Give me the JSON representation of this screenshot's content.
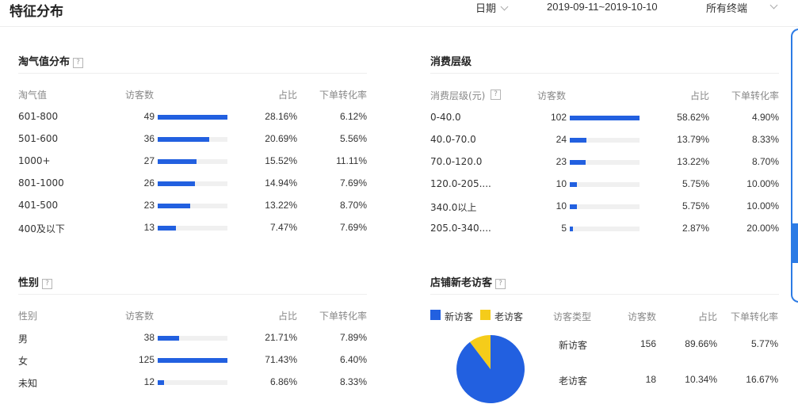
{
  "header": {
    "title": "特征分布",
    "date_label": "日期",
    "date_range": "2019-09-11~2019-10-10",
    "terminal": "所有终端"
  },
  "colors": {
    "bar": "#2260e0",
    "new_visitor": "#2260e0",
    "old_visitor": "#f5cc1a",
    "track": "#f0f0f0"
  },
  "taoqi": {
    "title": "淘气值分布",
    "help": "?",
    "headers": [
      "淘气值",
      "访客数",
      "占比",
      "下单转化率"
    ],
    "rows": [
      {
        "label": "601-800",
        "visitors": "49",
        "share": "28.16%",
        "conv": "6.12%"
      },
      {
        "label": "501-600",
        "visitors": "36",
        "share": "20.69%",
        "conv": "5.56%"
      },
      {
        "label": "1000+",
        "visitors": "27",
        "share": "15.52%",
        "conv": "11.11%"
      },
      {
        "label": "801-1000",
        "visitors": "26",
        "share": "14.94%",
        "conv": "7.69%"
      },
      {
        "label": "401-500",
        "visitors": "23",
        "share": "13.22%",
        "conv": "8.70%"
      },
      {
        "label": "400及以下",
        "visitors": "13",
        "share": "7.47%",
        "conv": "7.69%"
      }
    ]
  },
  "consumption": {
    "title": "消费层级",
    "help": "?",
    "headers": [
      "消费层级(元)",
      "访客数",
      "占比",
      "下单转化率"
    ],
    "rows": [
      {
        "label": "0-40.0",
        "visitors": "102",
        "share": "58.62%",
        "conv": "4.90%"
      },
      {
        "label": "40.0-70.0",
        "visitors": "24",
        "share": "13.79%",
        "conv": "8.33%"
      },
      {
        "label": "70.0-120.0",
        "visitors": "23",
        "share": "13.22%",
        "conv": "8.70%"
      },
      {
        "label": "120.0-205....",
        "visitors": "10",
        "share": "5.75%",
        "conv": "10.00%"
      },
      {
        "label": "340.0以上",
        "visitors": "10",
        "share": "5.75%",
        "conv": "10.00%"
      },
      {
        "label": "205.0-340....",
        "visitors": "5",
        "share": "2.87%",
        "conv": "20.00%"
      }
    ]
  },
  "gender": {
    "title": "性别",
    "help": "?",
    "headers": [
      "性别",
      "访客数",
      "占比",
      "下单转化率"
    ],
    "rows": [
      {
        "label": "男",
        "visitors": "38",
        "share": "21.71%",
        "conv": "7.89%"
      },
      {
        "label": "女",
        "visitors": "125",
        "share": "71.43%",
        "conv": "6.40%"
      },
      {
        "label": "未知",
        "visitors": "12",
        "share": "6.86%",
        "conv": "8.33%"
      }
    ]
  },
  "newold": {
    "title": "店铺新老访客",
    "help": "?",
    "legend_new": "新访客",
    "legend_old": "老访客",
    "headers": [
      "访客类型",
      "访客数",
      "占比",
      "下单转化率"
    ],
    "rows": [
      {
        "label": "新访客",
        "visitors": "156",
        "share": "89.66%",
        "conv": "5.77%"
      },
      {
        "label": "老访客",
        "visitors": "18",
        "share": "10.34%",
        "conv": "16.67%"
      }
    ]
  },
  "chart_data": {
    "type": "pie",
    "categories": [
      "新访客",
      "老访客"
    ],
    "values": [
      89.66,
      10.34
    ],
    "colors": [
      "#2260e0",
      "#f5cc1a"
    ]
  }
}
